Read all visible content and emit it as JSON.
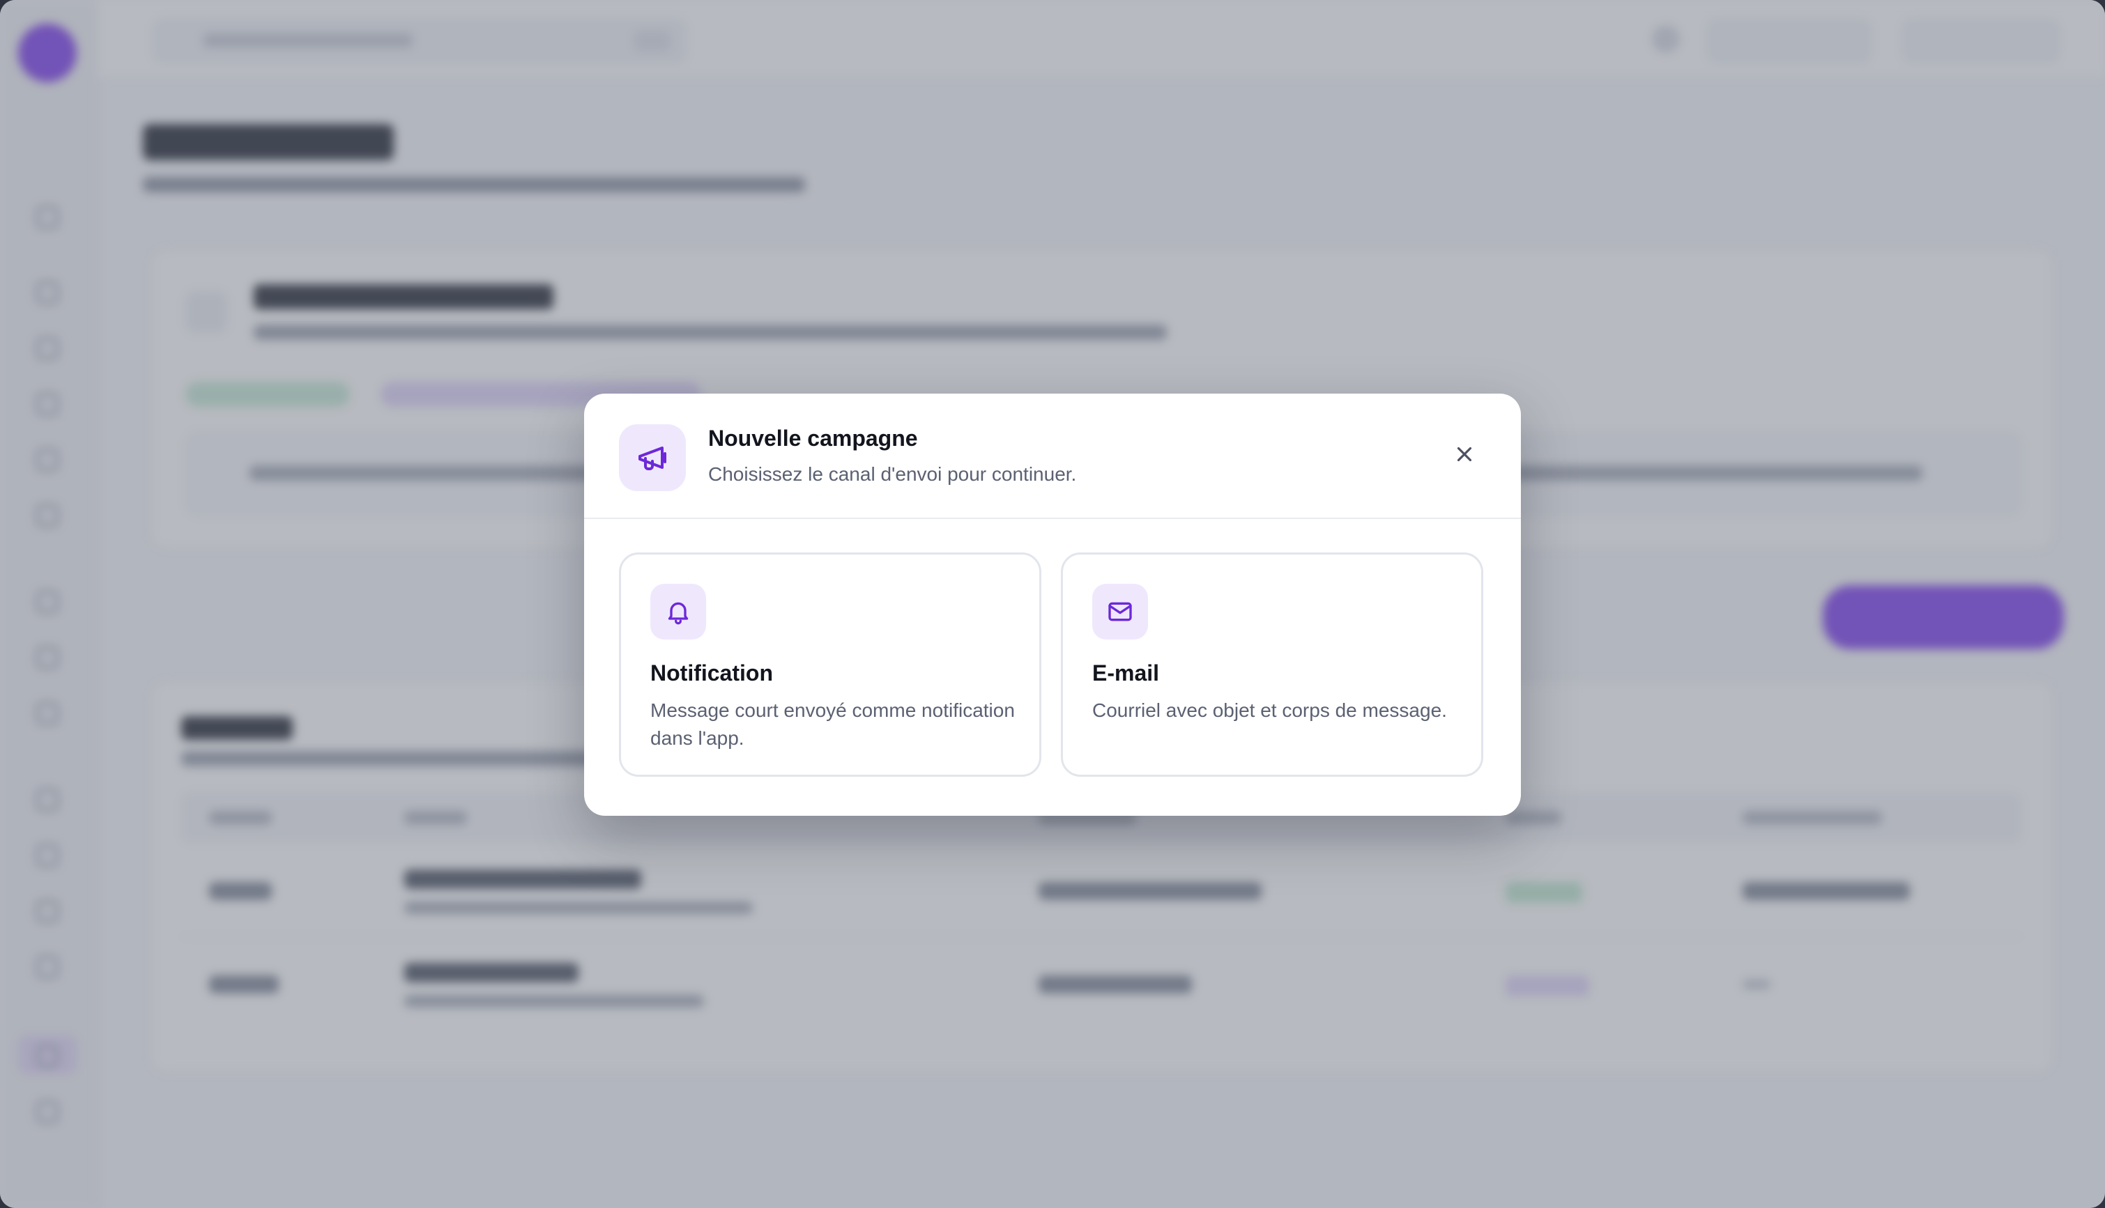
{
  "modal": {
    "title": "Nouvelle campagne",
    "subtitle": "Choisissez le canal d'envoi pour continuer.",
    "header_icon": "megaphone-icon",
    "close_icon": "close-icon",
    "options": [
      {
        "icon": "bell-icon",
        "title": "Notification",
        "description": "Message court envoyé comme notification dans l'app."
      },
      {
        "icon": "mail-icon",
        "title": "E-mail",
        "description": "Courriel avec objet et corps de message."
      }
    ]
  },
  "colors": {
    "accent": "#7c3aed",
    "accent_soft": "#efe8fd",
    "text_primary": "#12151d",
    "text_secondary": "#5b6172",
    "overlay": "rgba(105,110,124,0.48)"
  }
}
